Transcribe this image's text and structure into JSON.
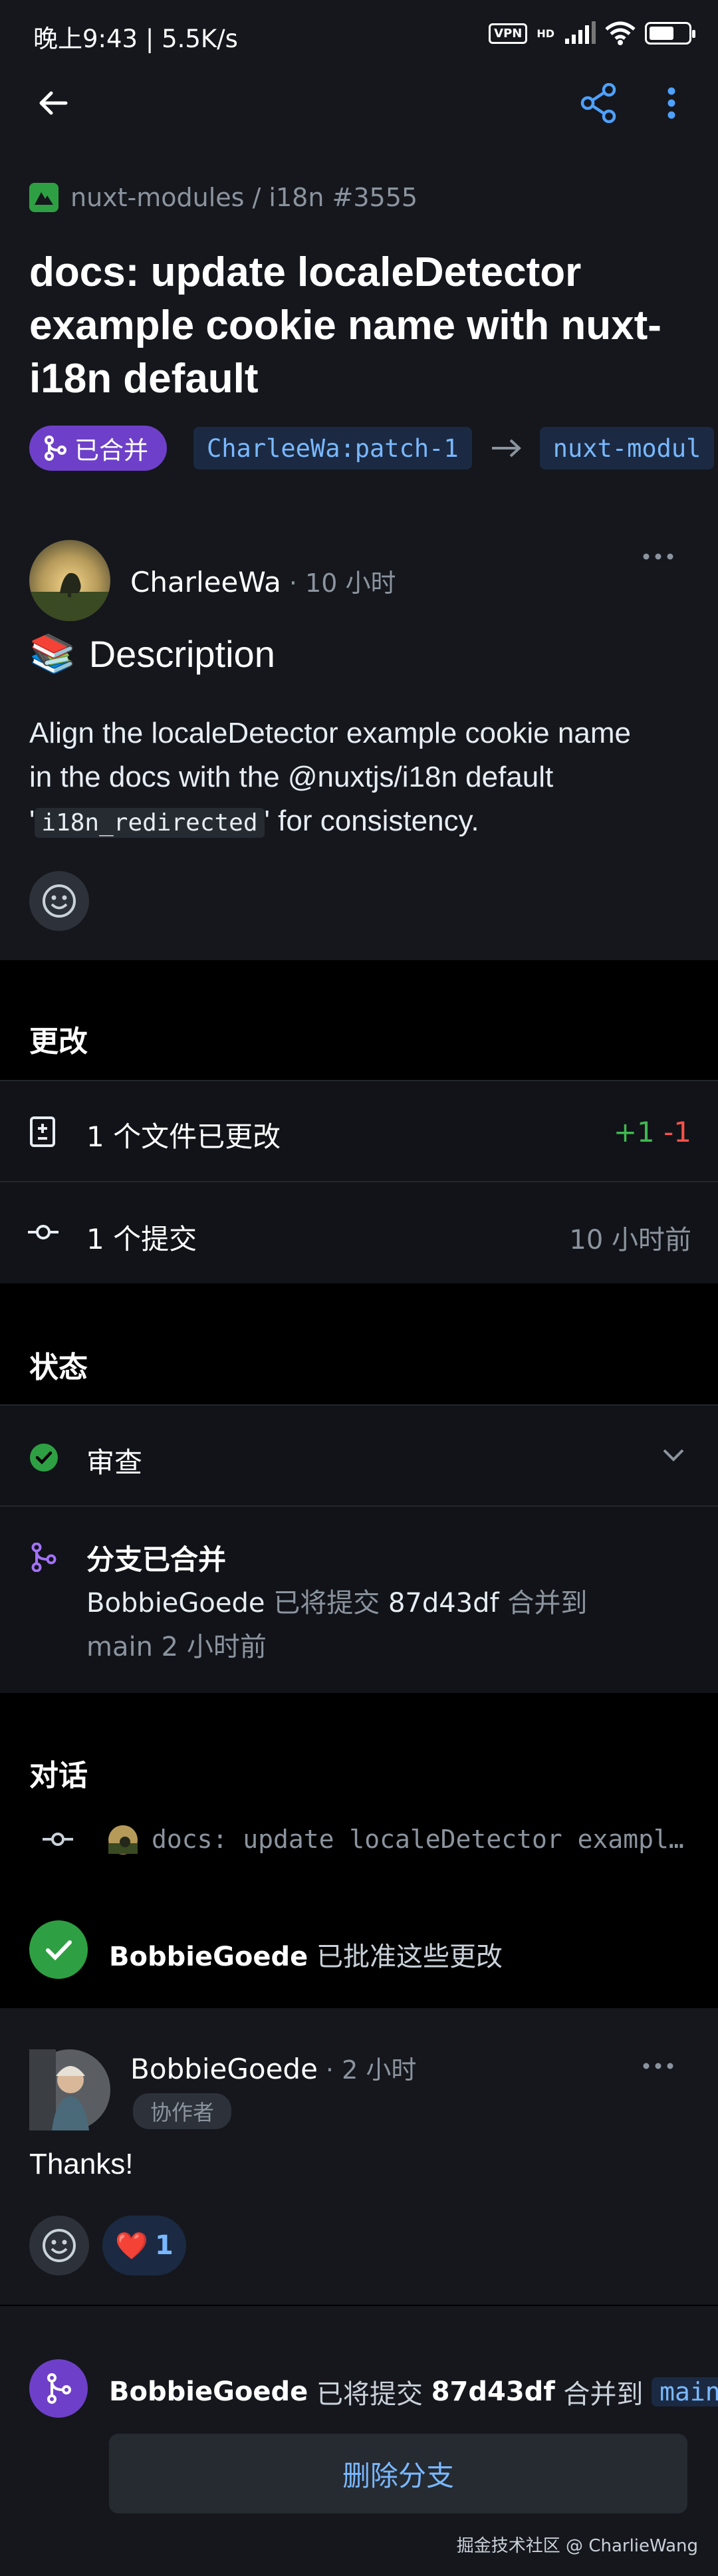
{
  "status_bar": {
    "time": "晚上9:43 | 5.5K/s",
    "vpn": "VPN",
    "hd": "HD",
    "battery_level": 0.62
  },
  "header": {
    "back_icon": "arrow-left-icon",
    "share_icon": "share-icon",
    "more_icon": "more-vertical-icon"
  },
  "pr": {
    "repo_path": "nuxt-modules / i18n #3555",
    "title": "docs: update localeDetector example cookie name with nuxt-i18n default",
    "state": "已合并",
    "head_branch": "CharleeWa:patch-1",
    "base_branch": "nuxt-modul",
    "author": "CharleeWa",
    "time": "· 10 小时",
    "description_heading": "Description",
    "description_emoji": "📚",
    "body_line1": "Align the localeDetector example cookie name",
    "body_line2": "in the docs with the @nuxtjs/i18n default",
    "body_quote_open": "'",
    "body_code": "i18n_redirected",
    "body_quote_close": "'",
    "body_line3_rest": " for consistency."
  },
  "changes": {
    "title": "更改",
    "files_label": "1 个文件已更改",
    "additions": "+1",
    "deletions": "-1",
    "commits_label": "1 个提交",
    "commits_time": "10 小时前"
  },
  "status": {
    "title": "状态",
    "review_label": "审查",
    "merged_title": "分支已合并",
    "merged_user": "BobbieGoede",
    "merged_text1": " 已将提交 ",
    "merged_commit": "87d43df",
    "merged_text2": " 合并到",
    "merged_line2": "main 2 小时前"
  },
  "conversation": {
    "title": "对话",
    "commit_message": "docs: update localeDetector exampl…",
    "approve_user": "BobbieGoede",
    "approve_text": " 已批准这些更改",
    "comment_author": "BobbieGoede",
    "comment_time": "· 2 小时",
    "comment_badge": "协作者",
    "comment_body": "Thanks!",
    "reaction_emoji": "❤️",
    "reaction_count": "1",
    "merge_user": "BobbieGoede",
    "merge_text1": " 已将提交 ",
    "merge_commit": "87d43df",
    "merge_text2": " 合并到 ",
    "merge_branch": "main",
    "delete_button": "删除分支"
  },
  "watermark": "掘金技术社区 @ CharlieWang",
  "colors": {
    "accent": "#79b8ff",
    "merged_purple": "#6e40c9",
    "success_green": "#2ea043",
    "addition_green": "#3fb950",
    "deletion_red": "#f85149"
  }
}
